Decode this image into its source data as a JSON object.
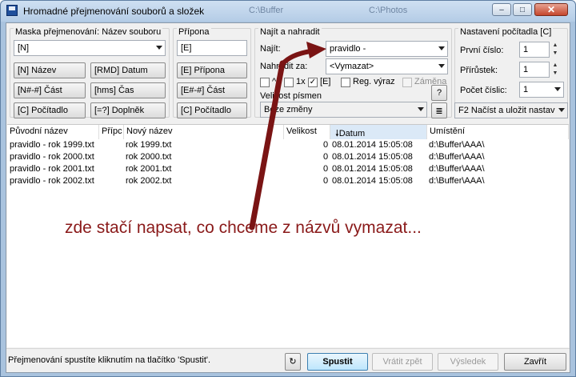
{
  "window": {
    "title": "Hromadné přejmenování souborů a složek",
    "ghost_tabs": [
      "C:\\Buffer",
      "C:\\Photos"
    ],
    "btn_minimize": "–",
    "btn_maximize": "□",
    "btn_close": "✕"
  },
  "mask": {
    "group_label": "Maska přejmenování: Název souboru",
    "input_value": "[N]",
    "buttons": [
      "[N] Název",
      "[RMD] Datum",
      "[N#-#] Část",
      "[hms] Čas",
      "[C] Počítadlo",
      "[=?] Doplněk"
    ]
  },
  "extension": {
    "group_label": "Přípona",
    "input_value": "[E]",
    "buttons": [
      "[E] Přípona",
      "[E#-#] Část",
      "[C] Počítadlo"
    ]
  },
  "find_replace": {
    "group_label": "Najít a nahradit",
    "find_label": "Najít:",
    "find_value": "pravidlo -",
    "replace_label": "Nahradit za:",
    "replace_value": "<Vymazat>",
    "opt_caret": "^",
    "opt_1x": "1x",
    "opt_E": "[E]",
    "opt_E_checked": "✓",
    "opt_regex": "Reg. výraz",
    "opt_swap": "Záměna",
    "case_label": "Velikost písmen",
    "case_value": "Beze změny",
    "help_button": "?",
    "list_button": "≣"
  },
  "counter": {
    "group_label": "Nastavení počítadla [C]",
    "first_label": "První číslo:",
    "first_value": "1",
    "step_label": "Přírůstek:",
    "step_value": "1",
    "digits_label": "Počet číslic:",
    "digits_value": "1",
    "settings_combo": "F2 Načíst a uložit nastav"
  },
  "list": {
    "columns": [
      "Původní název",
      "Přípc",
      "Nový název",
      "Velikost",
      "Datum",
      "Umístění"
    ],
    "rows": [
      {
        "orig": "pravidlo - rok 1999.txt",
        "new": "rok 1999.txt",
        "size": "0",
        "date": "08.01.2014 15:05:08",
        "loc": "d:\\Buffer\\AAA\\"
      },
      {
        "orig": "pravidlo - rok 2000.txt",
        "new": "rok 2000.txt",
        "size": "0",
        "date": "08.01.2014 15:05:08",
        "loc": "d:\\Buffer\\AAA\\"
      },
      {
        "orig": "pravidlo - rok 2001.txt",
        "new": "rok 2001.txt",
        "size": "0",
        "date": "08.01.2014 15:05:08",
        "loc": "d:\\Buffer\\AAA\\"
      },
      {
        "orig": "pravidlo - rok 2002.txt",
        "new": "rok 2002.txt",
        "size": "0",
        "date": "08.01.2014 15:05:08",
        "loc": "d:\\Buffer\\AAA\\"
      }
    ]
  },
  "annotation": {
    "text": "zde stačí napsat, co chceme z názvů vymazat...",
    "color": "#8a1a1a"
  },
  "status": {
    "text": "Přejmenování spustíte kliknutím na tlačítko 'Spustit'.",
    "undo_icon": "↻",
    "start": "Spustit",
    "undo": "Vrátit zpět",
    "result": "Výsledek",
    "close": "Zavřít"
  }
}
